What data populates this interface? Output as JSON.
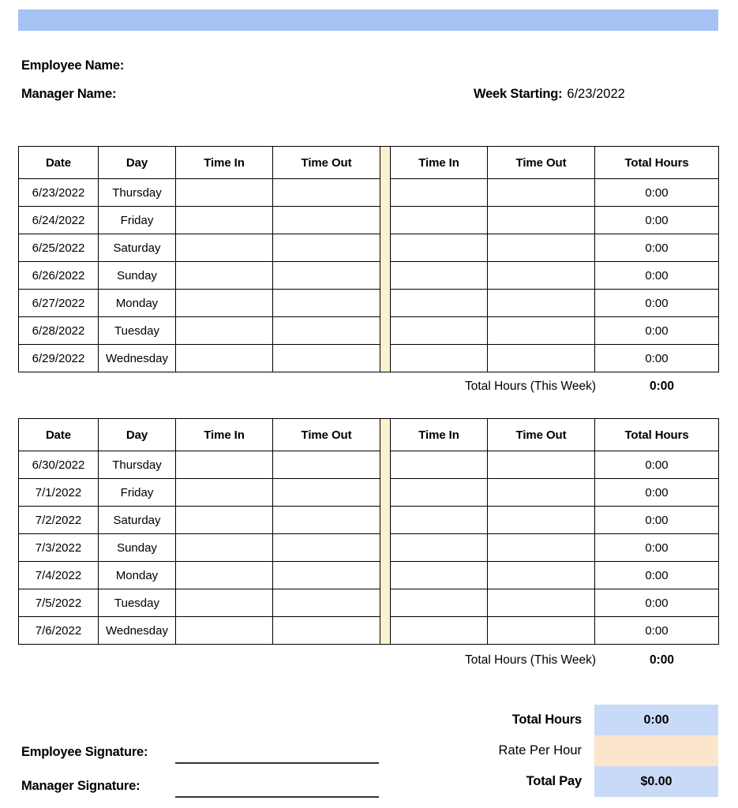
{
  "document": {
    "type": "weekly-timesheet",
    "banner_color": "#a4c2f4",
    "accent_blue": "#c9daf8",
    "accent_peach": "#fce5cd",
    "divider_cream": "#fdf2d0"
  },
  "header": {
    "employee_name_label": "Employee Name:",
    "employee_name_value": "",
    "manager_name_label": "Manager Name:",
    "manager_name_value": "",
    "week_starting_label": "Week Starting:",
    "week_starting_value": "6/23/2022"
  },
  "columns": {
    "date": "Date",
    "day": "Day",
    "time_in_1": "Time In",
    "time_out_1": "Time Out",
    "time_in_2": "Time In",
    "time_out_2": "Time Out",
    "total_hours": "Total Hours"
  },
  "week_1": {
    "rows": [
      {
        "date": "6/23/2022",
        "day": "Thursday",
        "time_in_1": "",
        "time_out_1": "",
        "time_in_2": "",
        "time_out_2": "",
        "total": "0:00"
      },
      {
        "date": "6/24/2022",
        "day": "Friday",
        "time_in_1": "",
        "time_out_1": "",
        "time_in_2": "",
        "time_out_2": "",
        "total": "0:00"
      },
      {
        "date": "6/25/2022",
        "day": "Saturday",
        "time_in_1": "",
        "time_out_1": "",
        "time_in_2": "",
        "time_out_2": "",
        "total": "0:00"
      },
      {
        "date": "6/26/2022",
        "day": "Sunday",
        "time_in_1": "",
        "time_out_1": "",
        "time_in_2": "",
        "time_out_2": "",
        "total": "0:00"
      },
      {
        "date": "6/27/2022",
        "day": "Monday",
        "time_in_1": "",
        "time_out_1": "",
        "time_in_2": "",
        "time_out_2": "",
        "total": "0:00"
      },
      {
        "date": "6/28/2022",
        "day": "Tuesday",
        "time_in_1": "",
        "time_out_1": "",
        "time_in_2": "",
        "time_out_2": "",
        "total": "0:00"
      },
      {
        "date": "6/29/2022",
        "day": "Wednesday",
        "time_in_1": "",
        "time_out_1": "",
        "time_in_2": "",
        "time_out_2": "",
        "total": "0:00"
      }
    ],
    "total_label": "Total Hours (This Week)",
    "total_value": "0:00"
  },
  "week_2": {
    "rows": [
      {
        "date": "6/30/2022",
        "day": "Thursday",
        "time_in_1": "",
        "time_out_1": "",
        "time_in_2": "",
        "time_out_2": "",
        "total": "0:00"
      },
      {
        "date": "7/1/2022",
        "day": "Friday",
        "time_in_1": "",
        "time_out_1": "",
        "time_in_2": "",
        "time_out_2": "",
        "total": "0:00"
      },
      {
        "date": "7/2/2022",
        "day": "Saturday",
        "time_in_1": "",
        "time_out_1": "",
        "time_in_2": "",
        "time_out_2": "",
        "total": "0:00"
      },
      {
        "date": "7/3/2022",
        "day": "Sunday",
        "time_in_1": "",
        "time_out_1": "",
        "time_in_2": "",
        "time_out_2": "",
        "total": "0:00"
      },
      {
        "date": "7/4/2022",
        "day": "Monday",
        "time_in_1": "",
        "time_out_1": "",
        "time_in_2": "",
        "time_out_2": "",
        "total": "0:00"
      },
      {
        "date": "7/5/2022",
        "day": "Tuesday",
        "time_in_1": "",
        "time_out_1": "",
        "time_in_2": "",
        "time_out_2": "",
        "total": "0:00"
      },
      {
        "date": "7/6/2022",
        "day": "Wednesday",
        "time_in_1": "",
        "time_out_1": "",
        "time_in_2": "",
        "time_out_2": "",
        "total": "0:00"
      }
    ],
    "total_label": "Total Hours (This Week)",
    "total_value": "0:00"
  },
  "summary": {
    "total_hours_label": "Total Hours",
    "total_hours_value": "0:00",
    "rate_per_hour_label": "Rate Per Hour",
    "rate_per_hour_value": "",
    "total_pay_label": "Total Pay",
    "total_pay_value": "$0.00"
  },
  "signatures": {
    "employee_label": "Employee Signature:",
    "employee_value": "",
    "manager_label": "Manager Signature:",
    "manager_value": ""
  }
}
